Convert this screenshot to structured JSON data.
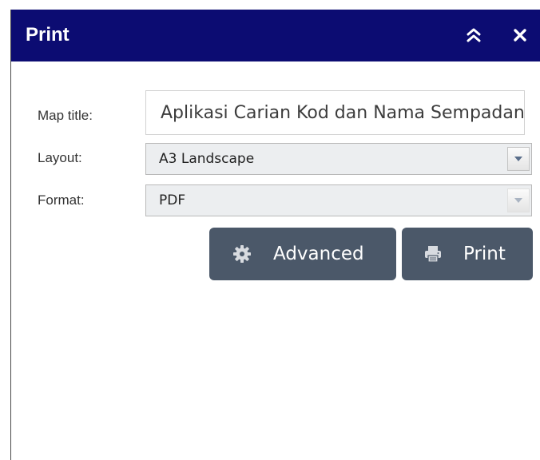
{
  "panel": {
    "title": "Print",
    "collapse_icon": "double-chevron-up-icon",
    "close_icon": "close-icon",
    "header_color": "#0c0c72"
  },
  "form": {
    "map_title_label": "Map title:",
    "map_title_value": "Aplikasi Carian Kod dan Nama Sempadan",
    "layout_label": "Layout:",
    "layout_value": "A3 Landscape",
    "format_label": "Format:",
    "format_value": "PDF"
  },
  "actions": {
    "advanced_label": "Advanced",
    "advanced_icon": "gear-icon",
    "print_label": "Print",
    "print_icon": "printer-icon",
    "button_color": "#4b5869"
  }
}
